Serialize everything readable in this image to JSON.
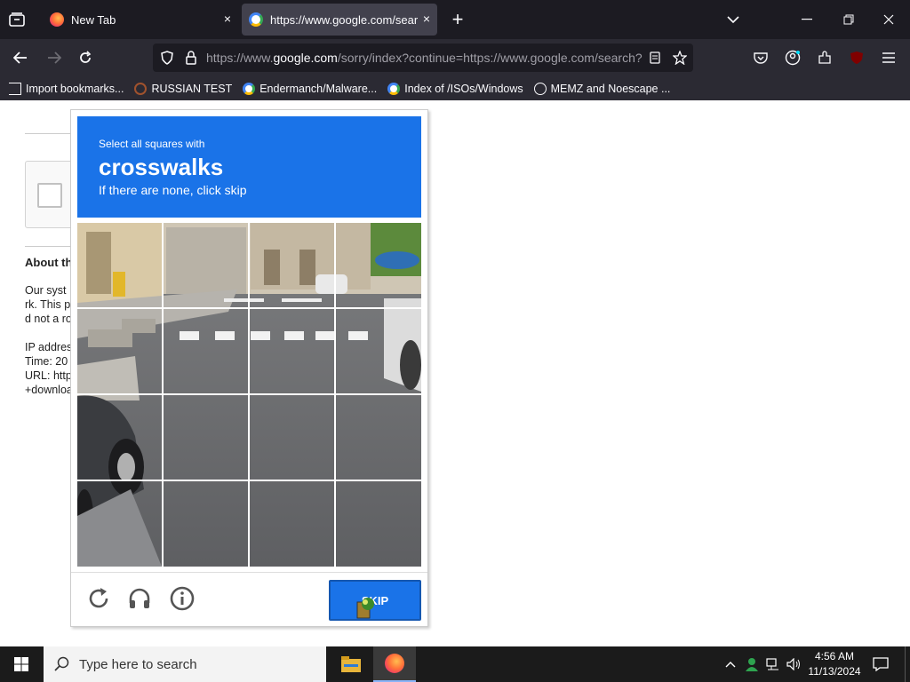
{
  "browser": {
    "tabs": [
      {
        "title": "New Tab",
        "close": "×"
      },
      {
        "title": "https://www.google.com/search?",
        "close": "×"
      }
    ],
    "new_tab_symbol": "+",
    "url_prefix": "https://www.",
    "url_host": "google.com",
    "url_rest": "/sorry/index?continue=https://www.google.com/search?",
    "bookmarks": [
      {
        "label": "Import bookmarks...",
        "icon": "import-icon"
      },
      {
        "label": "RUSSIAN TEST",
        "icon": "reddit-icon"
      },
      {
        "label": "Endermanch/Malware...",
        "icon": "google-icon"
      },
      {
        "label": "Index of /ISOs/Windows",
        "icon": "google-icon"
      },
      {
        "label": "MEMZ and Noescape ...",
        "icon": "globe-icon"
      }
    ]
  },
  "page": {
    "about_heading": "About th",
    "paragraph_lines": [
      "Our syst",
      "rk. This p",
      "d not a ro",
      "",
      "IP addres",
      "Time: 20",
      "URL: http",
      "+downloa"
    ]
  },
  "captcha": {
    "instruction_small": "Select all squares with",
    "target": "crosswalks",
    "instruction_sub": "If there are none, click skip",
    "skip_label": "SKIP",
    "accent_color": "#1a73e8"
  },
  "taskbar": {
    "search_placeholder": "Type here to search",
    "time": "4:56 AM",
    "date": "11/13/2024"
  }
}
